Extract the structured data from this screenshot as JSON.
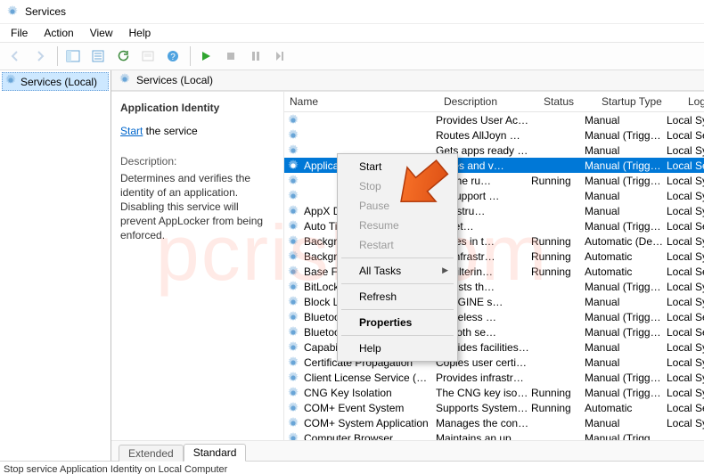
{
  "title": "Services",
  "menus": [
    "File",
    "Action",
    "View",
    "Help"
  ],
  "tree": {
    "root": "Services (Local)"
  },
  "panel": {
    "header": "Services (Local)"
  },
  "leftpane": {
    "service_name": "Application Identity",
    "link_action": "Start",
    "link_suffix": " the service",
    "desc_label": "Description:",
    "desc_text": "Determines and verifies the identity of an application. Disabling this service will prevent AppLocker from being enforced."
  },
  "columns": {
    "name": "Name",
    "desc": "Description",
    "status": "Status",
    "startup": "Startup Type",
    "logon": "Log On As"
  },
  "services": [
    {
      "name": "",
      "desc": "Provides User Acc…",
      "status": "",
      "startup": "Manual",
      "logon": "Local System"
    },
    {
      "name": "",
      "desc": "Routes AllJoyn …",
      "status": "",
      "startup": "Manual (Trigg…",
      "logon": "Local Service"
    },
    {
      "name": "",
      "desc": "Gets apps ready f…",
      "status": "",
      "startup": "Manual",
      "logon": "Local System"
    },
    {
      "name": "Application",
      "desc": "mines and v…",
      "status": "",
      "startup": "Manual (Trigg…",
      "logon": "Local Service",
      "selected": true
    },
    {
      "name": "",
      "desc": "tes the ru…",
      "status": "Running",
      "startup": "Manual (Trigg…",
      "logon": "Local System"
    },
    {
      "name": "",
      "desc": "es support …",
      "status": "",
      "startup": "Manual",
      "logon": "Local System"
    },
    {
      "name": "AppX Depl",
      "desc": "infrastru…",
      "status": "",
      "startup": "Manual",
      "logon": "Local System"
    },
    {
      "name": "Auto Time",
      "desc": "lly set…",
      "status": "",
      "startup": "Manual (Trigg…",
      "logon": "Local Service"
    },
    {
      "name": "Backgroun",
      "desc": "rs files in t…",
      "status": "Running",
      "startup": "Automatic (De…",
      "logon": "Local System"
    },
    {
      "name": "Backgroun",
      "desc": "ws infrastr…",
      "status": "Running",
      "startup": "Automatic",
      "logon": "Local System"
    },
    {
      "name": "Base Filter",
      "desc": "se Filterin…",
      "status": "Running",
      "startup": "Automatic",
      "logon": "Local Service"
    },
    {
      "name": "BitLocker D",
      "desc": "C hosts th…",
      "status": "",
      "startup": "Manual (Trigg…",
      "logon": "Local System"
    },
    {
      "name": "Block Leve",
      "desc": "BENGINE s…",
      "status": "",
      "startup": "Manual",
      "logon": "Local System"
    },
    {
      "name": "Bluetooth",
      "desc": "s wireless …",
      "status": "",
      "startup": "Manual (Trigg…",
      "logon": "Local Service"
    },
    {
      "name": "Bluetooth",
      "desc": "uetooth se…",
      "status": "",
      "startup": "Manual (Trigg…",
      "logon": "Local Service"
    },
    {
      "name": "Capability Access Manager S…",
      "desc": "Provides facilities…",
      "status": "",
      "startup": "Manual",
      "logon": "Local System"
    },
    {
      "name": "Certificate Propagation",
      "desc": "Copies user certif…",
      "status": "",
      "startup": "Manual",
      "logon": "Local System"
    },
    {
      "name": "Client License Service (ClipSV…",
      "desc": "Provides infrastru…",
      "status": "",
      "startup": "Manual (Trigg…",
      "logon": "Local System"
    },
    {
      "name": "CNG Key Isolation",
      "desc": "The CNG key isol…",
      "status": "Running",
      "startup": "Manual (Trigg…",
      "logon": "Local System"
    },
    {
      "name": "COM+ Event System",
      "desc": "Supports System …",
      "status": "Running",
      "startup": "Automatic",
      "logon": "Local Service"
    },
    {
      "name": "COM+ System Application",
      "desc": "Manages the con…",
      "status": "",
      "startup": "Manual",
      "logon": "Local System"
    },
    {
      "name": "Computer Browser",
      "desc": "Maintains an up…",
      "status": "",
      "startup": "Manual (Trigg…",
      "logon": ""
    }
  ],
  "context_menu": {
    "start": "Start",
    "stop": "Stop",
    "pause": "Pause",
    "resume": "Resume",
    "restart": "Restart",
    "alltasks": "All Tasks",
    "refresh": "Refresh",
    "properties": "Properties",
    "help": "Help"
  },
  "tabs": {
    "extended": "Extended",
    "standard": "Standard"
  },
  "status_text": "Stop service Application Identity on Local Computer",
  "watermark": "pcrisk.com"
}
